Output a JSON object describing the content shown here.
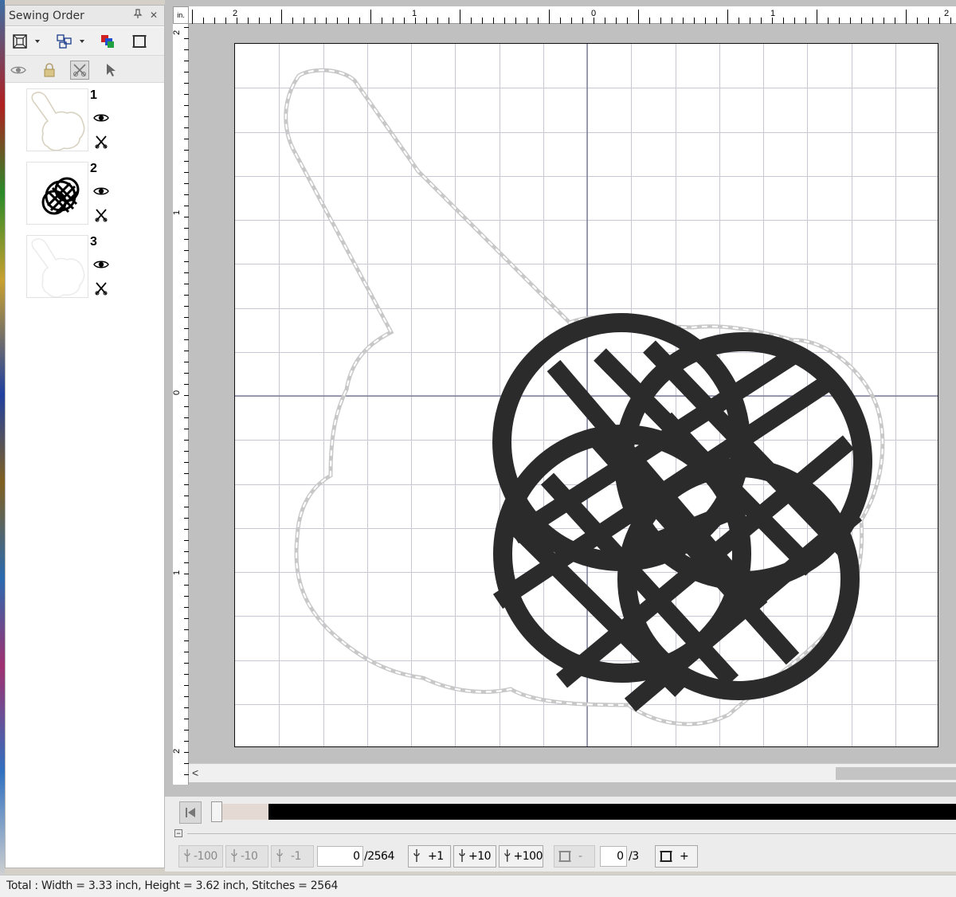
{
  "panel": {
    "title": "Sewing Order",
    "pin_glyph": "↕",
    "close_glyph": "✕",
    "toolbar1_icons": [
      "fit-icon",
      "group-icon",
      "color-order-icon",
      "frame-icon"
    ],
    "toolbar2_icons": [
      "eye-icon",
      "lock-icon",
      "cut-icon",
      "pointer-icon"
    ],
    "items": [
      {
        "number": "1",
        "thumb": "outline-tag-icon",
        "visible": true
      },
      {
        "number": "2",
        "thumb": "celtic-knot-icon",
        "visible": true
      },
      {
        "number": "3",
        "thumb": "outline-tag-icon",
        "visible": true
      }
    ]
  },
  "canvas": {
    "ruler_unit": "in.",
    "top_ruler_labels": [
      "2",
      "1",
      "0",
      "1",
      "2"
    ],
    "left_ruler_labels": [
      "2",
      "1",
      "0",
      "1",
      "2"
    ],
    "scroll_left_glyph": "<",
    "page_color": "#ffffff",
    "grid_color": "#c8c8d4",
    "axis_color": "#6a6a8a",
    "stitch_color": "#2b2b2b",
    "outline_color": "#b8b8b8"
  },
  "stitch_toolbar": {
    "minus100": "-100",
    "minus10": "-10",
    "minus1": "-1",
    "stitch_value": "0",
    "stitch_total": "/2564",
    "plus1": "+1",
    "plus10": "+10",
    "plus100": "+100",
    "frame_minus": "-",
    "frame_value": "0",
    "frame_total": "/3",
    "frame_plus": "+"
  },
  "status": {
    "text": "Total : Width = 3.33 inch, Height = 3.62 inch, Stitches = 2564"
  }
}
